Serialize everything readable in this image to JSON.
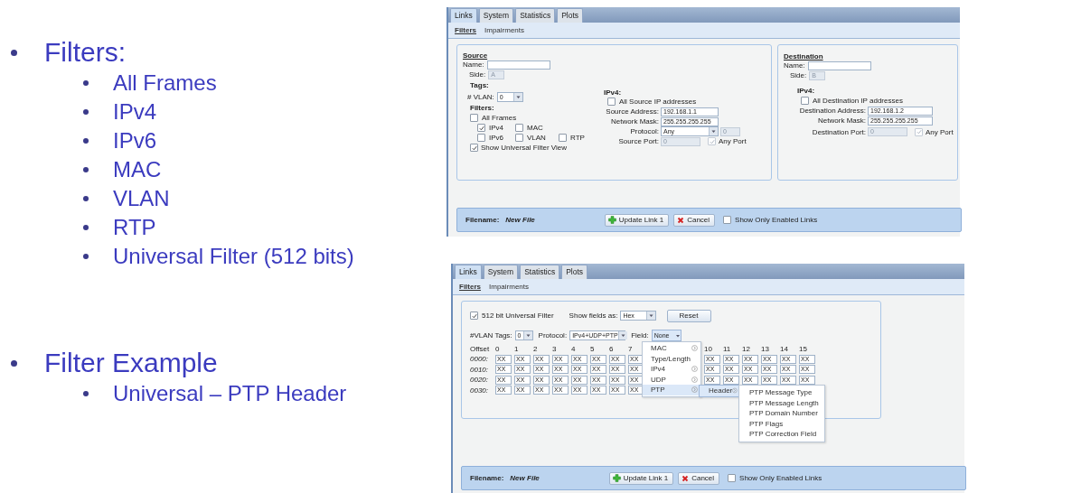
{
  "slide": {
    "bullets": [
      {
        "text": "Filters:",
        "children": [
          {
            "text": "All Frames"
          },
          {
            "text": "IPv4"
          },
          {
            "text": "IPv6"
          },
          {
            "text": "MAC"
          },
          {
            "text": "VLAN"
          },
          {
            "text": "RTP"
          },
          {
            "text": "Universal Filter (512 bits)"
          }
        ]
      },
      {
        "text": "Filter Example",
        "children": [
          {
            "text": "Universal – PTP Header"
          }
        ]
      }
    ]
  },
  "screenshots": [
    {
      "kind": "link_filters",
      "tabs": [
        {
          "label": "Links",
          "selected": true
        },
        {
          "label": "System",
          "selected": false
        },
        {
          "label": "Statistics",
          "selected": false
        },
        {
          "label": "Plots",
          "selected": false
        }
      ],
      "subtabs": [
        {
          "label": "Filters",
          "selected": true
        },
        {
          "label": "Impairments",
          "selected": false
        }
      ],
      "source": {
        "heading": "Source",
        "name": {
          "label": "Name:"
        },
        "side": {
          "label": "Side:",
          "value": "A",
          "disabled": true
        },
        "tags_heading": "Tags:",
        "vlan": {
          "label": "# VLAN:",
          "value": "0"
        },
        "filters_heading": "Filters:",
        "filter_rows": [
          [
            {
              "label": "All Frames",
              "checked": false
            }
          ],
          [
            {
              "label": "IPv4",
              "checked": true
            },
            {
              "label": "MAC",
              "checked": false
            }
          ],
          [
            {
              "label": "IPv6",
              "checked": false
            },
            {
              "label": "VLAN",
              "checked": false
            },
            {
              "label": "RTP",
              "checked": false
            }
          ]
        ],
        "universal_view": {
          "label": "Show Universal Filter View",
          "checked": true
        },
        "ipv4": {
          "heading": "IPv4:",
          "all": {
            "label": "All Source IP addresses",
            "checked": false
          },
          "fields": [
            {
              "label": "Source Address:",
              "value": "192.168.1.1"
            },
            {
              "label": "Network Mask:",
              "value": "255.255.255.255"
            }
          ],
          "protocol": {
            "label": "Protocol:",
            "value": "Any",
            "number": {
              "value": "0",
              "disabled": true
            }
          },
          "port": {
            "label": "Source Port:",
            "value": "0",
            "disabled": true,
            "any_port": {
              "label": "Any Port",
              "checked": true,
              "disabled": true
            }
          }
        }
      },
      "destination": {
        "heading": "Destination",
        "name": {
          "label": "Name:"
        },
        "side": {
          "label": "Side:",
          "value": "B",
          "disabled": true
        },
        "ipv4": {
          "heading": "IPv4:",
          "all": {
            "label": "All Destination IP addresses",
            "checked": false
          },
          "fields": [
            {
              "label": "Destination Address:",
              "value": "192.168.1.2"
            },
            {
              "label": "Network Mask:",
              "value": "255.255.255.255"
            }
          ],
          "port": {
            "label": "Destination Port:",
            "value": "0",
            "disabled": true,
            "any_port": {
              "label": "Any Port",
              "checked": true,
              "disabled": true
            }
          }
        }
      },
      "footer": {
        "filename_label": "Filename:",
        "filename": "New File",
        "buttons": [
          {
            "kind": "update",
            "label": "Update Link 1"
          },
          {
            "kind": "cancel",
            "label": "Cancel"
          }
        ],
        "enabled_only": {
          "label": "Show Only Enabled Links",
          "checked": false
        }
      }
    },
    {
      "kind": "universal_filter",
      "tabs": [
        {
          "label": "Links",
          "selected": true
        },
        {
          "label": "System",
          "selected": false
        },
        {
          "label": "Statistics",
          "selected": false
        },
        {
          "label": "Plots",
          "selected": false
        }
      ],
      "subtabs": [
        {
          "label": "Filters",
          "selected": true
        },
        {
          "label": "Impairments",
          "selected": false
        }
      ],
      "universal": {
        "enable": {
          "label": "512 bit Universal Filter",
          "checked": true
        },
        "show_fields": {
          "label": "Show fields as:",
          "value": "Hex"
        },
        "reset": "Reset",
        "vlan_tags": {
          "label": "#VLAN Tags:",
          "value": "0"
        },
        "protocol": {
          "label": "Protocol:",
          "value": "IPv4+UDP+PTP"
        },
        "field": {
          "label": "Field:",
          "value": "None"
        },
        "grid": {
          "offset_label": "Offset",
          "columns": [
            "0",
            "1",
            "2",
            "3",
            "4",
            "5",
            "6",
            "7",
            "10",
            "11",
            "12",
            "13",
            "14",
            "15"
          ],
          "rows": [
            {
              "offset": "0000:",
              "cells": [
                "XX",
                "XX",
                "XX",
                "XX",
                "XX",
                "XX",
                "XX",
                "XX",
                "XX",
                "XX",
                "XX",
                "XX",
                "XX",
                "XX"
              ]
            },
            {
              "offset": "0010:",
              "cells": [
                "XX",
                "XX",
                "XX",
                "XX",
                "XX",
                "XX",
                "XX",
                "XX",
                "XX",
                "XX",
                "XX",
                "XX",
                "XX",
                "XX"
              ]
            },
            {
              "offset": "0020:",
              "cells": [
                "XX",
                "XX",
                "XX",
                "XX",
                "XX",
                "XX",
                "XX",
                "XX",
                "XX",
                "XX",
                "XX",
                "XX",
                "XX",
                "XX"
              ]
            },
            {
              "offset": "0030:",
              "cells": [
                "XX",
                "XX",
                "XX",
                "XX",
                "XX",
                "XX",
                "XX",
                "XX"
              ]
            }
          ]
        }
      },
      "menu": {
        "items": [
          {
            "label": "MAC",
            "submenu": true,
            "selected": false
          },
          {
            "label": "Type/Length",
            "submenu": false,
            "selected": false
          },
          {
            "label": "IPv4",
            "submenu": true,
            "selected": false
          },
          {
            "label": "UDP",
            "submenu": true,
            "selected": false
          },
          {
            "label": "PTP",
            "submenu": true,
            "selected": true
          }
        ],
        "submenu": [
          {
            "label": "Header",
            "submenu": true,
            "selected": true
          }
        ],
        "fields": [
          "PTP Message Type",
          "PTP Message Length",
          "PTP Domain Number",
          "PTP Flags",
          "PTP Correction Field"
        ]
      },
      "footer": {
        "filename_label": "Filename:",
        "filename": "New File",
        "buttons": [
          {
            "kind": "update",
            "label": "Update Link 1"
          },
          {
            "kind": "cancel",
            "label": "Cancel"
          }
        ],
        "enabled_only": {
          "label": "Show Only Enabled Links",
          "checked": false
        }
      }
    }
  ]
}
